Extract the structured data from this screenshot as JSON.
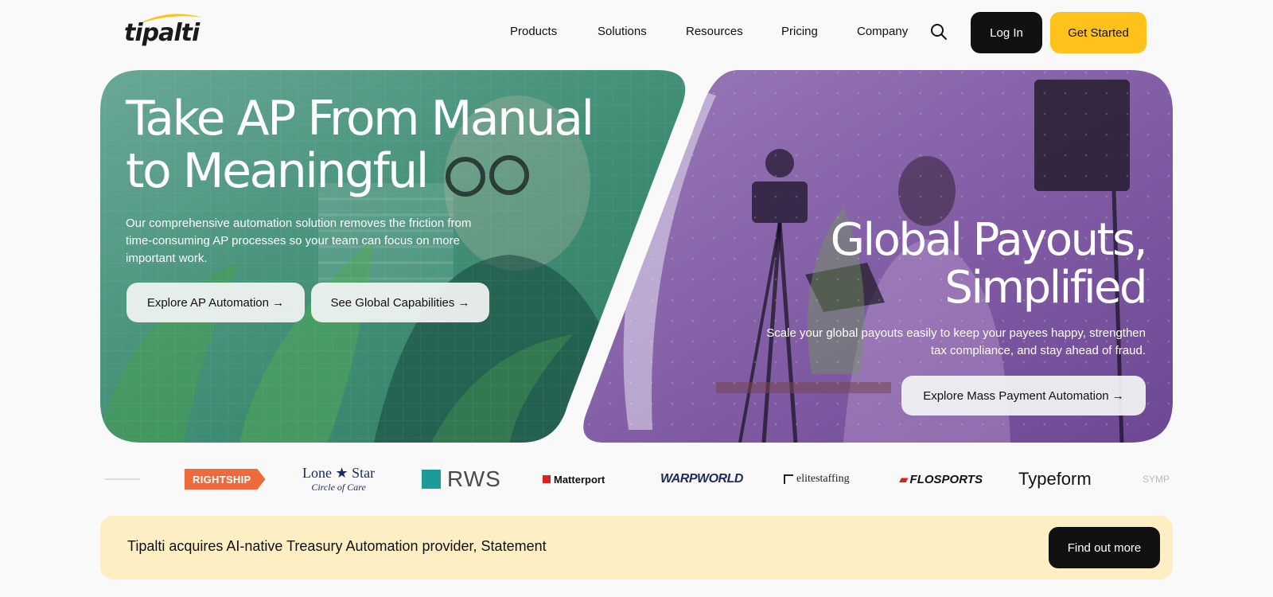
{
  "header": {
    "logo_text": "tipalti",
    "nav": [
      "Products",
      "Solutions",
      "Resources",
      "Pricing",
      "Company"
    ],
    "login_label": "Log In",
    "get_started_label": "Get Started"
  },
  "hero": {
    "left": {
      "title_line1": "Take AP From Manual",
      "title_line2": "to Meaningful",
      "description": "Our comprehensive automation solution removes the friction from time-consuming AP processes so your team can focus on more important work.",
      "button_primary": "Explore AP Automation →",
      "button_secondary": "See Global Capabilities →"
    },
    "right": {
      "title_line1": "Global Payouts,",
      "title_line2": "Simplified",
      "description": "Scale your global payouts easily to keep your payees happy, strengthen tax compliance, and stay ahead of fraud.",
      "button": "Explore Mass Payment Automation →"
    }
  },
  "logos": {
    "rightship": "RIGHTSHIP",
    "lonestar_line1": "Lone ★ Star",
    "lonestar_line2": "Circle of Care",
    "rws": "RWS",
    "matterport": "Matterport",
    "warpworld": "WARPWORLD",
    "elitestaffing": "elitestaffing",
    "flosports": "FLOSPORTS",
    "typeform": "Typeform",
    "faded_right": "SYMP"
  },
  "banner": {
    "text": "Tipalti acquires AI-native Treasury Automation provider, Statement",
    "button": "Find out more"
  },
  "colors": {
    "left_panel": "#4f9a84",
    "right_panel": "#8a63ad",
    "accent_yellow": "#ffc21a",
    "banner_bg": "#fdeec3"
  }
}
